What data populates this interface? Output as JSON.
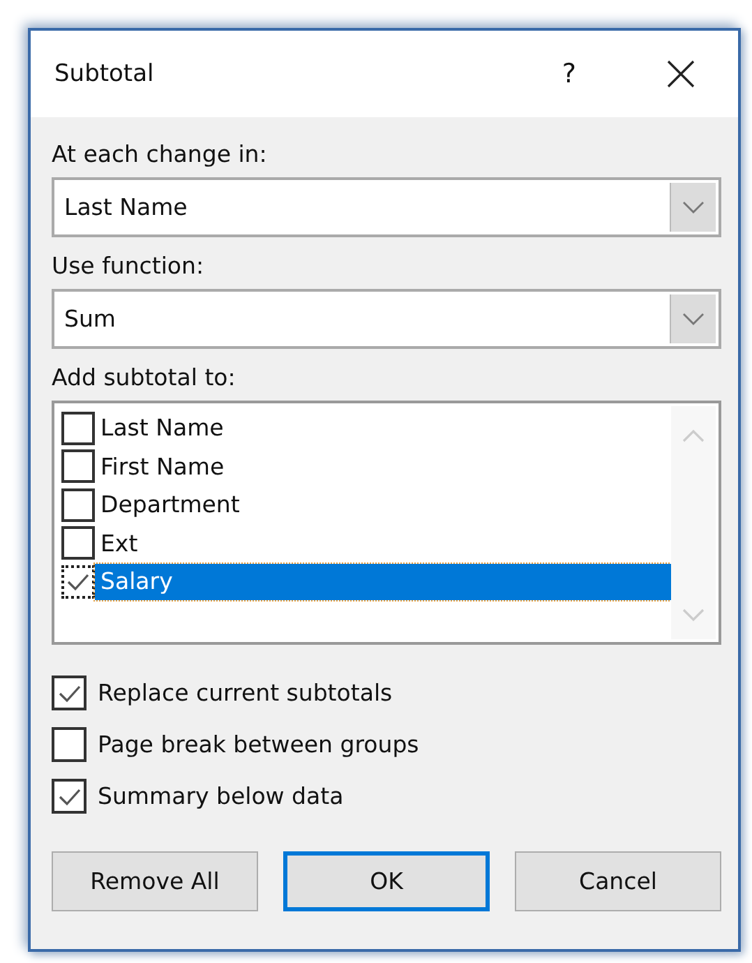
{
  "window": {
    "title": "Subtotal",
    "help": "?"
  },
  "dropdowns": [
    {
      "label": "At each change in:",
      "value": "Last Name"
    },
    {
      "label": "Use function:",
      "value": "Sum"
    }
  ],
  "subtotal_list": {
    "label": "Add subtotal to:",
    "items": [
      {
        "label": "Last Name",
        "checked": false,
        "selected": false
      },
      {
        "label": "First Name",
        "checked": false,
        "selected": false
      },
      {
        "label": "Department",
        "checked": false,
        "selected": false
      },
      {
        "label": "Ext",
        "checked": false,
        "selected": false
      },
      {
        "label": "Salary",
        "checked": true,
        "selected": true
      }
    ]
  },
  "options": [
    {
      "label": "Replace current subtotals",
      "checked": true
    },
    {
      "label": "Page break between groups",
      "checked": false
    },
    {
      "label": "Summary below data",
      "checked": true
    }
  ],
  "buttons": [
    {
      "label": "Remove All",
      "default": false
    },
    {
      "label": "OK",
      "default": true
    },
    {
      "label": "Cancel",
      "default": false
    }
  ]
}
